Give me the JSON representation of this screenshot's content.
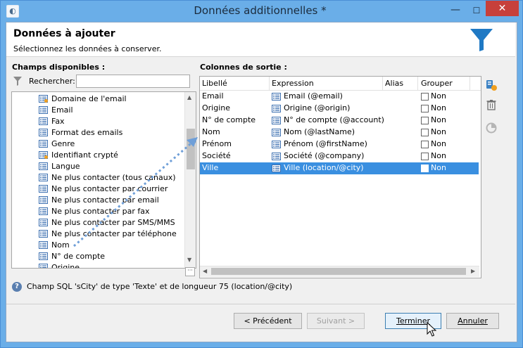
{
  "window": {
    "title": "Données additionnelles *",
    "app_icon": "app-logo-icon"
  },
  "header": {
    "title": "Données à ajouter",
    "subtitle": "Sélectionnez les données à conserver."
  },
  "left_panel": {
    "title": "Champs disponibles :",
    "search_label": "Rechercher:",
    "search_value": "",
    "items": [
      {
        "label": "Domaine de l'email",
        "icon": "computed-field-icon"
      },
      {
        "label": "Email",
        "icon": "field-icon"
      },
      {
        "label": "Fax",
        "icon": "field-icon"
      },
      {
        "label": "Format des emails",
        "icon": "field-icon"
      },
      {
        "label": "Genre",
        "icon": "field-icon"
      },
      {
        "label": "Identifiant crypté",
        "icon": "computed-field-icon"
      },
      {
        "label": "Langue",
        "icon": "field-icon"
      },
      {
        "label": "Ne plus contacter (tous canaux)",
        "icon": "field-icon"
      },
      {
        "label": "Ne plus contacter par courrier",
        "icon": "field-icon"
      },
      {
        "label": "Ne plus contacter par email",
        "icon": "field-icon"
      },
      {
        "label": "Ne plus contacter par fax",
        "icon": "field-icon"
      },
      {
        "label": "Ne plus contacter par SMS/MMS",
        "icon": "field-icon"
      },
      {
        "label": "Ne plus contacter par téléphone",
        "icon": "field-icon"
      },
      {
        "label": "Nom",
        "icon": "field-icon"
      },
      {
        "label": "N° de compte",
        "icon": "field-icon"
      },
      {
        "label": "Origine",
        "icon": "field-icon"
      }
    ]
  },
  "right_panel": {
    "title": "Colonnes de sortie :",
    "columns": [
      "Libellé",
      "Expression",
      "Alias",
      "Grouper"
    ],
    "rows": [
      {
        "label": "Email",
        "expression": "Email (@email)",
        "alias": "",
        "group": "Non",
        "selected": false
      },
      {
        "label": "Origine",
        "expression": "Origine (@origin)",
        "alias": "",
        "group": "Non",
        "selected": false
      },
      {
        "label": "N° de compte",
        "expression": "N° de compte (@account)",
        "alias": "",
        "group": "Non",
        "selected": false
      },
      {
        "label": "Nom",
        "expression": "Nom (@lastName)",
        "alias": "",
        "group": "Non",
        "selected": false
      },
      {
        "label": "Prénom",
        "expression": "Prénom (@firstName)",
        "alias": "",
        "group": "Non",
        "selected": false
      },
      {
        "label": "Société",
        "expression": "Société (@company)",
        "alias": "",
        "group": "Non",
        "selected": false
      },
      {
        "label": "Ville",
        "expression": "Ville (location/@city)",
        "alias": "",
        "group": "Non",
        "selected": true
      }
    ]
  },
  "info_text": "Champ SQL 'sCity' de type 'Texte' et de longueur 75 (location/@city)",
  "buttons": {
    "previous": "< Précédent",
    "next": "Suivant >",
    "finish": "Terminer",
    "cancel": "Annuler"
  },
  "colors": {
    "titlebar": "#6aaee8",
    "selection": "#3a8fe0",
    "close_button": "#c7403b",
    "accent": "#1f79c4"
  }
}
